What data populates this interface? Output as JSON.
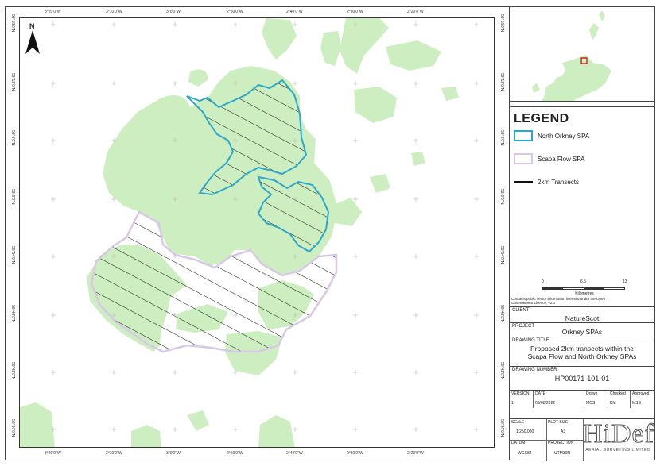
{
  "lon_ticks": [
    "3°20'0\"W",
    "3°10'0\"W",
    "3°0'0\"W",
    "2°50'0\"W",
    "2°40'0\"W",
    "2°30'0\"W",
    "2°20'0\"W"
  ],
  "lat_ticks": [
    "59°18'0\"N",
    "59°12'0\"N",
    "59°6'0\"N",
    "59°0'0\"N",
    "58°54'0\"N",
    "58°48'0\"N",
    "58°42'0\"N",
    "58°36'0\"N"
  ],
  "north_label": "N",
  "legend": {
    "title": "LEGEND",
    "items": [
      {
        "label": "North Orkney  SPA",
        "color": "#2ea8c9"
      },
      {
        "label": "Scapa Flow SPA",
        "color": "#d9c7e8"
      },
      {
        "label": "2km Transects",
        "color": "#111111"
      }
    ]
  },
  "scale": {
    "ticks": [
      "0",
      "6.5",
      "13"
    ],
    "unit": "Kilometres"
  },
  "note": "Contains public sector information licensed under the Open Governement Licence, v2.0",
  "client": {
    "label": "CLIENT",
    "value": "NatureScot"
  },
  "project": {
    "label": "PROJECT",
    "value": "Orkney SPAs"
  },
  "drawing_title": {
    "label": "DRAWING TITLE",
    "line1": "Proposed 2km transects within the",
    "line2": "Scapa Flow and North Orkney SPAs"
  },
  "drawing_number": {
    "label": "DRAWING NUMBER",
    "value": "HP00171-101-01"
  },
  "revision_table": {
    "headers": [
      "VERSION",
      "DATE",
      "Drawn",
      "Checked",
      "Approved"
    ],
    "values": [
      "1",
      "03/08/2022",
      "MCS",
      "KM",
      "MSS"
    ]
  },
  "info": {
    "scale_label": "SCALE",
    "scale_value": "1:250,000",
    "plot_label": "PLOT SIZE",
    "plot_value": "A3",
    "datum_label": "DATUM",
    "datum_value": "WGS84",
    "projection_label": "PROJECTION",
    "projection_value": "UTM30N"
  },
  "logo": {
    "text": "HiDef",
    "sub": "AERIAL SURVEYING LIMITED"
  },
  "colors": {
    "land": "#cdeec1",
    "north_orkney": "#2ea8c9",
    "scapa_flow": "#d9c7e8",
    "transect": "#111111"
  }
}
